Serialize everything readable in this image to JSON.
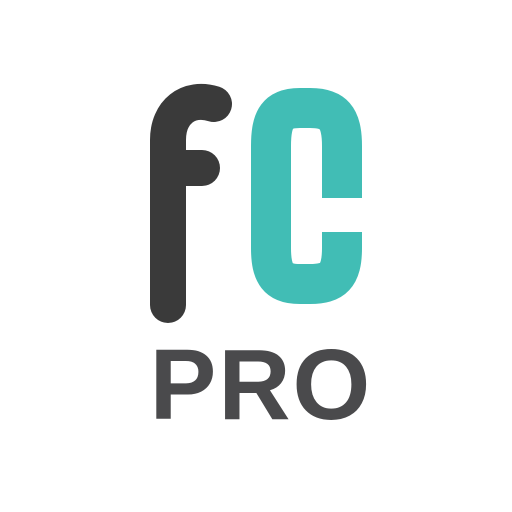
{
  "logo": {
    "monogram_f": "f",
    "monogram_c": "C",
    "wordmark": "PRO",
    "colors": {
      "f": "#3a3a3a",
      "c": "#41bdb5",
      "wordmark": "#4a4a4c",
      "background": "#ffffff"
    }
  }
}
